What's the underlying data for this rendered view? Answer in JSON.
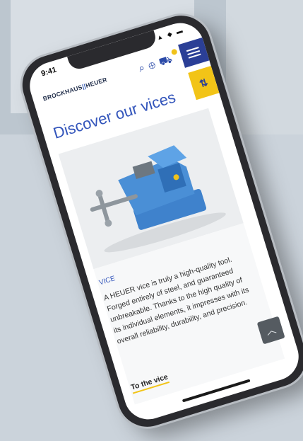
{
  "status": {
    "time": "9:41",
    "icons": "▲ ◆ ▬"
  },
  "header": {
    "logo_left": "BROCKHAUS",
    "logo_sep": "||",
    "logo_right": "HEUER",
    "icons": [
      "search-icon",
      "globe-icon",
      "cart-icon"
    ],
    "filter_glyph": "⇅"
  },
  "page": {
    "title": "Discover our vices",
    "product_category": "VICE",
    "description": "A HEUER vice is truly a high-quality tool. Forged entirely of steel, and guaranteed unbreakable. Thanks to the high quality of its individual elements, it impresses with its overall reliability, durability, and precision.",
    "link_label": "To the vice",
    "scroll_top_glyph": "︿"
  },
  "colors": {
    "accent_blue": "#3355bb",
    "accent_yellow": "#f2c417",
    "vice_blue": "#4a8fd6"
  }
}
